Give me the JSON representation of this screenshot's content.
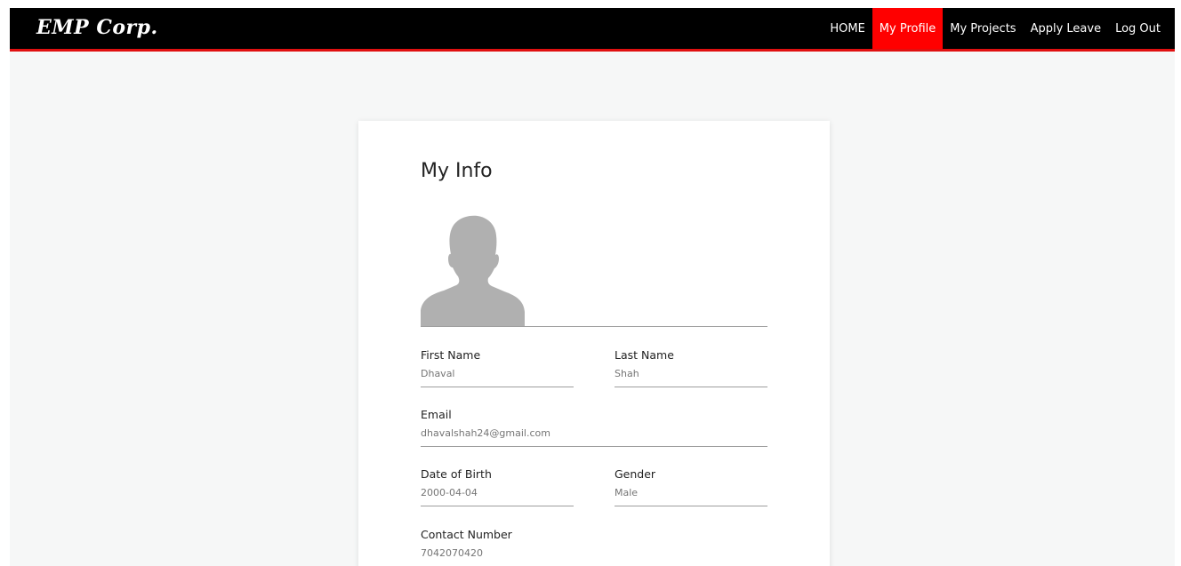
{
  "brand": "EMP Corp.",
  "nav": {
    "items": [
      {
        "label": "HOME",
        "active": false
      },
      {
        "label": "My Profile",
        "active": true
      },
      {
        "label": "My Projects",
        "active": false
      },
      {
        "label": "Apply Leave",
        "active": false
      },
      {
        "label": "Log Out",
        "active": false
      }
    ]
  },
  "colors": {
    "navbar_bg": "#000000",
    "accent_red": "#ff0000",
    "page_bg": "#f6f7f7",
    "card_bg": "#ffffff"
  },
  "profile": {
    "title": "My Info",
    "avatar_icon": "user-silhouette-icon",
    "fields": {
      "first_name": {
        "label": "First Name",
        "value": "Dhaval"
      },
      "last_name": {
        "label": "Last Name",
        "value": "Shah"
      },
      "email": {
        "label": "Email",
        "value": "dhavalshah24@gmail.com"
      },
      "dob": {
        "label": "Date of Birth",
        "value": "2000-04-04"
      },
      "gender": {
        "label": "Gender",
        "value": "Male"
      },
      "contact": {
        "label": "Contact Number",
        "value": "7042070420"
      }
    }
  }
}
